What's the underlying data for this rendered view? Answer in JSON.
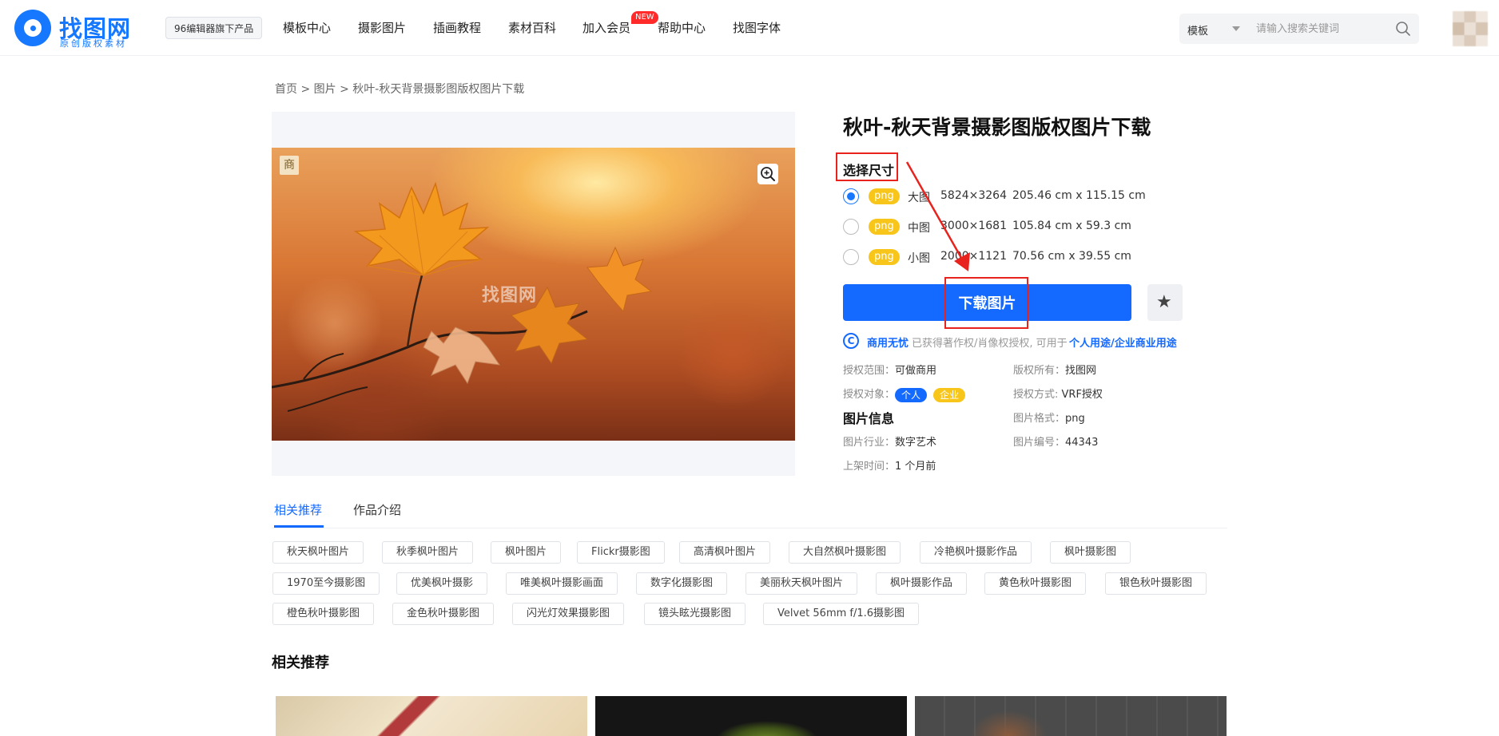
{
  "header": {
    "logo_name": "找图网",
    "logo_tag": "原创版权素材",
    "badge": "96编辑器旗下产品",
    "nav": [
      {
        "label": "模板中心"
      },
      {
        "label": "摄影图片"
      },
      {
        "label": "插画教程"
      },
      {
        "label": "素材百科"
      },
      {
        "label": "加入会员"
      },
      {
        "label": "帮助中心"
      },
      {
        "label": "找图字体"
      }
    ],
    "new_badge": "NEW",
    "search": {
      "type": "模板",
      "placeholder": "请输入搜索关键词"
    }
  },
  "breadcrumb": "首页 > 图片 > 秋叶-秋天背景摄影图版权图片下载",
  "image": {
    "commercial_badge": "商",
    "watermark": "找图网"
  },
  "detail": {
    "title": "秋叶-秋天背景摄影图版权图片下载",
    "size_label": "选择尺寸",
    "sizes": [
      {
        "format": "png",
        "name": "大图",
        "pixels": "5824×3264",
        "cm": "205.46 cm x 115.15 cm",
        "selected": true
      },
      {
        "format": "png",
        "name": "中图",
        "pixels": "3000×1681",
        "cm": "105.84 cm x 59.3 cm",
        "selected": false
      },
      {
        "format": "png",
        "name": "小图",
        "pixels": "2000×1121",
        "cm": "70.56 cm x 39.55 cm",
        "selected": false
      }
    ],
    "download_label": "下载图片",
    "license": {
      "strong": "商用无忧",
      "text": "已获得著作权/肖像权授权, 可用于",
      "link": "个人用途/企业商业用途"
    },
    "meta": {
      "scope_label": "授权范围：",
      "scope_value": "可做商用",
      "owner_label": "版权所有：",
      "owner_value": "找图网",
      "target_label": "授权对象：",
      "target_personal": "个人",
      "target_company": "企业",
      "method_label": "授权方式:",
      "method_value": "VRF授权",
      "info_heading": "图片信息",
      "format_label": "图片格式：",
      "format_value": "png",
      "industry_label": "图片行业：",
      "industry_value": "数字艺术",
      "id_label": "图片编号：",
      "id_value": "44343",
      "time_label": "上架时间：",
      "time_value": "1 个月前"
    }
  },
  "tabs": [
    {
      "label": "相关推荐",
      "active": true
    },
    {
      "label": "作品介绍",
      "active": false
    }
  ],
  "keywords": [
    "秋天枫叶图片",
    "秋季枫叶图片",
    "枫叶图片",
    "Flickr摄影图",
    "高清枫叶图片",
    "大自然枫叶摄影图",
    "冷艳枫叶摄影作品",
    "枫叶摄影图",
    "1970至今摄影图",
    "优美枫叶摄影",
    "唯美枫叶摄影画面",
    "数字化摄影图",
    "美丽秋天枫叶图片",
    "枫叶摄影作品",
    "黄色秋叶摄影图",
    "银色秋叶摄影图",
    "橙色秋叶摄影图",
    "金色秋叶摄影图",
    "闪光灯效果摄影图",
    "镜头眩光摄影图",
    "Velvet 56mm f/1.6摄影图"
  ],
  "related_title": "相关推荐",
  "colors": {
    "brand": "#1677ff",
    "button": "#1469ff",
    "format_badge": "#f8c61a",
    "annotation": "#e8231d"
  }
}
